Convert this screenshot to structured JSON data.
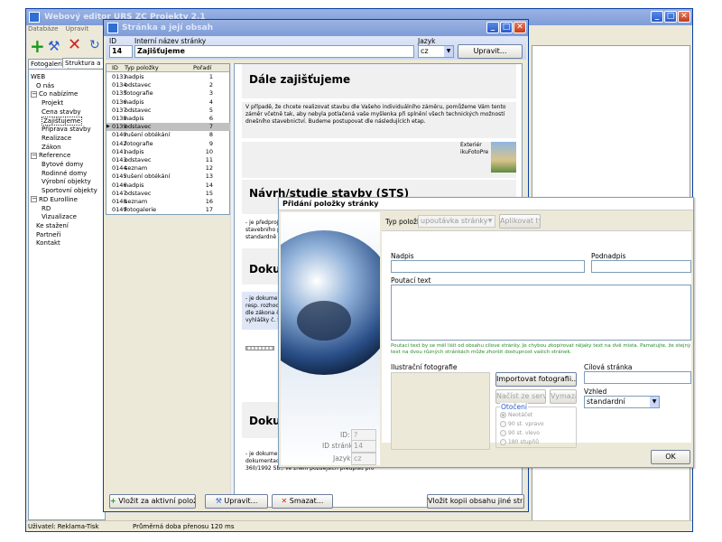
{
  "main_window": {
    "title": "Webový editor URS ZC Projekty 2.1",
    "menu": [
      "Databáze",
      "Upravit"
    ],
    "tabs": [
      "Fotogalerie",
      "Struktura a obsah"
    ],
    "tree": [
      {
        "label": "WEB",
        "level": 0,
        "expander": ""
      },
      {
        "label": "O nás",
        "level": 1,
        "expander": ""
      },
      {
        "label": "Co nabízíme",
        "level": 0,
        "expander": "−"
      },
      {
        "label": "Projekt",
        "level": 2,
        "expander": ""
      },
      {
        "label": "Cena stavby",
        "level": 2,
        "expander": ""
      },
      {
        "label": "Zajišťujeme",
        "level": 2,
        "expander": "",
        "selected": true
      },
      {
        "label": "Příprava stavby",
        "level": 2,
        "expander": ""
      },
      {
        "label": "Realizace",
        "level": 2,
        "expander": ""
      },
      {
        "label": "Zákon",
        "level": 2,
        "expander": ""
      },
      {
        "label": "Reference",
        "level": 0,
        "expander": "−"
      },
      {
        "label": "Bytové domy",
        "level": 2,
        "expander": ""
      },
      {
        "label": "Rodinné domy",
        "level": 2,
        "expander": ""
      },
      {
        "label": "Výrobní objekty",
        "level": 2,
        "expander": ""
      },
      {
        "label": "Sportovní objekty",
        "level": 2,
        "expander": ""
      },
      {
        "label": "RD Eurolline",
        "level": 0,
        "expander": "−"
      },
      {
        "label": "RD",
        "level": 2,
        "expander": ""
      },
      {
        "label": "Vizualizace",
        "level": 2,
        "expander": ""
      },
      {
        "label": "Ke stažení",
        "level": 1,
        "expander": ""
      },
      {
        "label": "Partneři",
        "level": 1,
        "expander": ""
      },
      {
        "label": "Kontakt",
        "level": 1,
        "expander": ""
      }
    ],
    "status": {
      "user": "Uživatel: Reklama-Tisk",
      "transfer": "Průměrná doba přenosu 120 ms"
    }
  },
  "page_window": {
    "title": "Stránka a její obsah",
    "id_label": "ID",
    "id_value": "14",
    "name_label": "Interní název stránky",
    "name_value": "Zajišťujeme",
    "lang_label": "Jazyk",
    "lang_value": "cz",
    "edit_button": "Upravit...",
    "list_headers": {
      "id": "ID",
      "type": "Typ položky",
      "order": "Pořadí"
    },
    "items": [
      {
        "id": "0133",
        "type": "nadpis",
        "order": "1"
      },
      {
        "id": "0134",
        "type": "odstavec",
        "order": "2"
      },
      {
        "id": "0135",
        "type": "fotografie",
        "order": "3"
      },
      {
        "id": "0136",
        "type": "nadpis",
        "order": "4"
      },
      {
        "id": "0137",
        "type": "odstavec",
        "order": "5"
      },
      {
        "id": "0138",
        "type": "nadpis",
        "order": "6"
      },
      {
        "id": "0139",
        "type": "odstavec",
        "order": "7",
        "selected": true
      },
      {
        "id": "0140",
        "type": "rušení obtékání",
        "order": "8"
      },
      {
        "id": "0142",
        "type": "fotografie",
        "order": "9"
      },
      {
        "id": "0141",
        "type": "nadpis",
        "order": "10"
      },
      {
        "id": "0143",
        "type": "odstavec",
        "order": "11"
      },
      {
        "id": "0144",
        "type": "seznam",
        "order": "12"
      },
      {
        "id": "0145",
        "type": "rušení obtékání",
        "order": "13"
      },
      {
        "id": "0146",
        "type": "nadpis",
        "order": "14"
      },
      {
        "id": "0147",
        "type": "odstavec",
        "order": "15"
      },
      {
        "id": "0148",
        "type": "seznam",
        "order": "16"
      },
      {
        "id": "0149",
        "type": "fotogalerie",
        "order": "17"
      }
    ],
    "preview": {
      "heading1": "Dále zajišťujeme",
      "para1": "V případě, že chcete realizovat stavbu dle Vašeho individuálního záměru, pomůžeme Vám tento záměr včetně tak, aby nebyla potlačená vaše myšlenka při splnění všech technických možností dnešního stavebnictví. Budeme postupovat dle následujících etap.",
      "photo_caption1": "Exteriér",
      "photo_caption2": "ikuFotoPre",
      "heading2": "Návrh/studie stavby (STS)",
      "para2": "- je předprojekt",
      "para2b": "stavebního p",
      "para2c": "standardně v",
      "heading3": "Dokum",
      "para3a": "- je dokument",
      "para3b": "resp. rozhod",
      "para3c": "dle zákona č",
      "para3d": "vyhlášky č. S",
      "heading4": "Dokum",
      "para4a": "- je dokument",
      "para4b": "dokumentac",
      "para4c": "360/1992 Sb., ve znění pozdějších předpisů pro"
    },
    "bottom_buttons": {
      "insert": "Vložit za aktivní položku...",
      "edit": "Upravit...",
      "delete": "Smazat...",
      "copy": "Vložit kopii obsahu jiné stránky..."
    }
  },
  "dialog": {
    "title": "Přidání položky stránky",
    "type_label": "Typ položky",
    "type_value": "upoutávka stránky",
    "apply_type": "Aplikovat typ",
    "heading_label": "Nadpis",
    "subheading_label": "Podnadpis",
    "text_label": "Poutací text",
    "hint": "Poutací text by se měl lišit od obsahu cílové stránky. Je chybou zkopírovat nějaký text na dvě místa. Pamatujte, že stejný text na dvou různých stránkách může zhoršit dostupnost vašich stránek.",
    "photo_label": "Ilustrační fotografie",
    "import_photo": "Importovat fotografii...",
    "load_server": "Načíst ze serveru",
    "crop": "Vymazat...",
    "rotation_label": "Otočení",
    "rotations": [
      "Neotáčet",
      "90 st. vpravo",
      "90 st. vlevo",
      "180 stupňů"
    ],
    "target_label": "Cílová stránka",
    "look_label": "Vzhled",
    "look_value": "standardní",
    "id_label": "ID:",
    "id_value": "?",
    "page_id_label": "ID stránka",
    "page_id_value": "14",
    "lang_label": "Jazyk",
    "lang_value": "cz",
    "ok": "OK"
  },
  "colors": {
    "titlebar": "#0a3fa6",
    "hint_green": "#2a8a2a",
    "selection": "#0a246a"
  }
}
